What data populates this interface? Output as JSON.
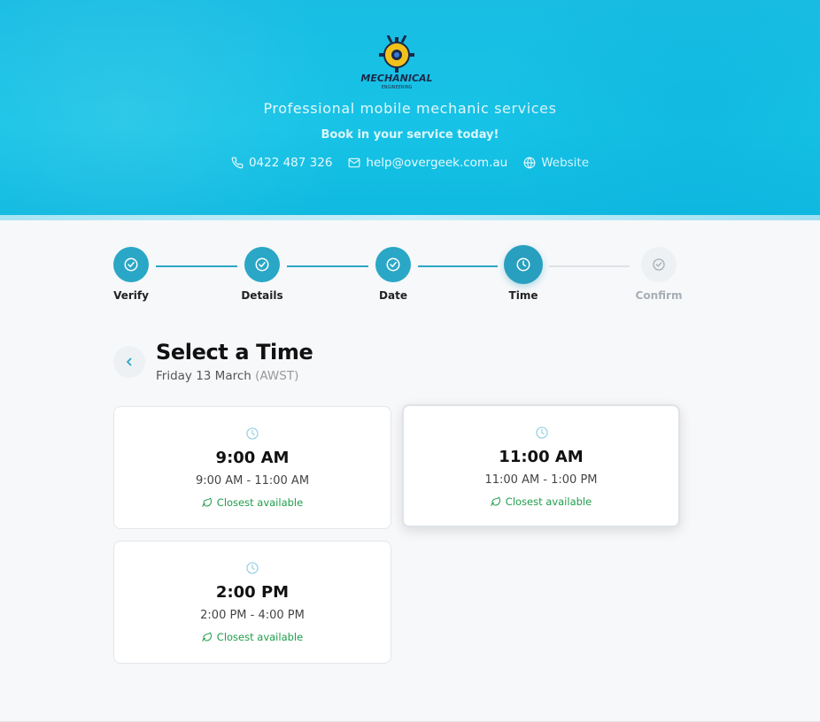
{
  "header": {
    "logo_text": "MECHANICAL",
    "logo_subtext": "ENGINEERING",
    "tagline": "Professional mobile mechanic services",
    "subline": "Book in your service today!",
    "contacts": {
      "phone": "0422 487 326",
      "email": "help@overgeek.com.au",
      "website": "Website"
    },
    "colors": {
      "brand": "#16c3e6",
      "accent": "#2aa7c6"
    }
  },
  "stepper": {
    "steps": [
      {
        "label": "Verify",
        "state": "done",
        "icon": "check-circle-icon"
      },
      {
        "label": "Details",
        "state": "done",
        "icon": "check-circle-icon"
      },
      {
        "label": "Date",
        "state": "done",
        "icon": "check-circle-icon"
      },
      {
        "label": "Time",
        "state": "current",
        "icon": "clock-icon"
      },
      {
        "label": "Confirm",
        "state": "pending",
        "icon": "check-circle-icon"
      }
    ]
  },
  "section": {
    "title": "Select a Time",
    "date": "Friday 13 March",
    "timezone": "(AWST)"
  },
  "slots": [
    {
      "time": "9:00 AM",
      "range": "9:00 AM - 11:00 AM",
      "badge": "Closest available",
      "selected": false
    },
    {
      "time": "11:00 AM",
      "range": "11:00 AM - 1:00 PM",
      "badge": "Closest available",
      "selected": true
    },
    {
      "time": "2:00 PM",
      "range": "2:00 PM - 4:00 PM",
      "badge": "Closest available",
      "selected": false
    }
  ]
}
